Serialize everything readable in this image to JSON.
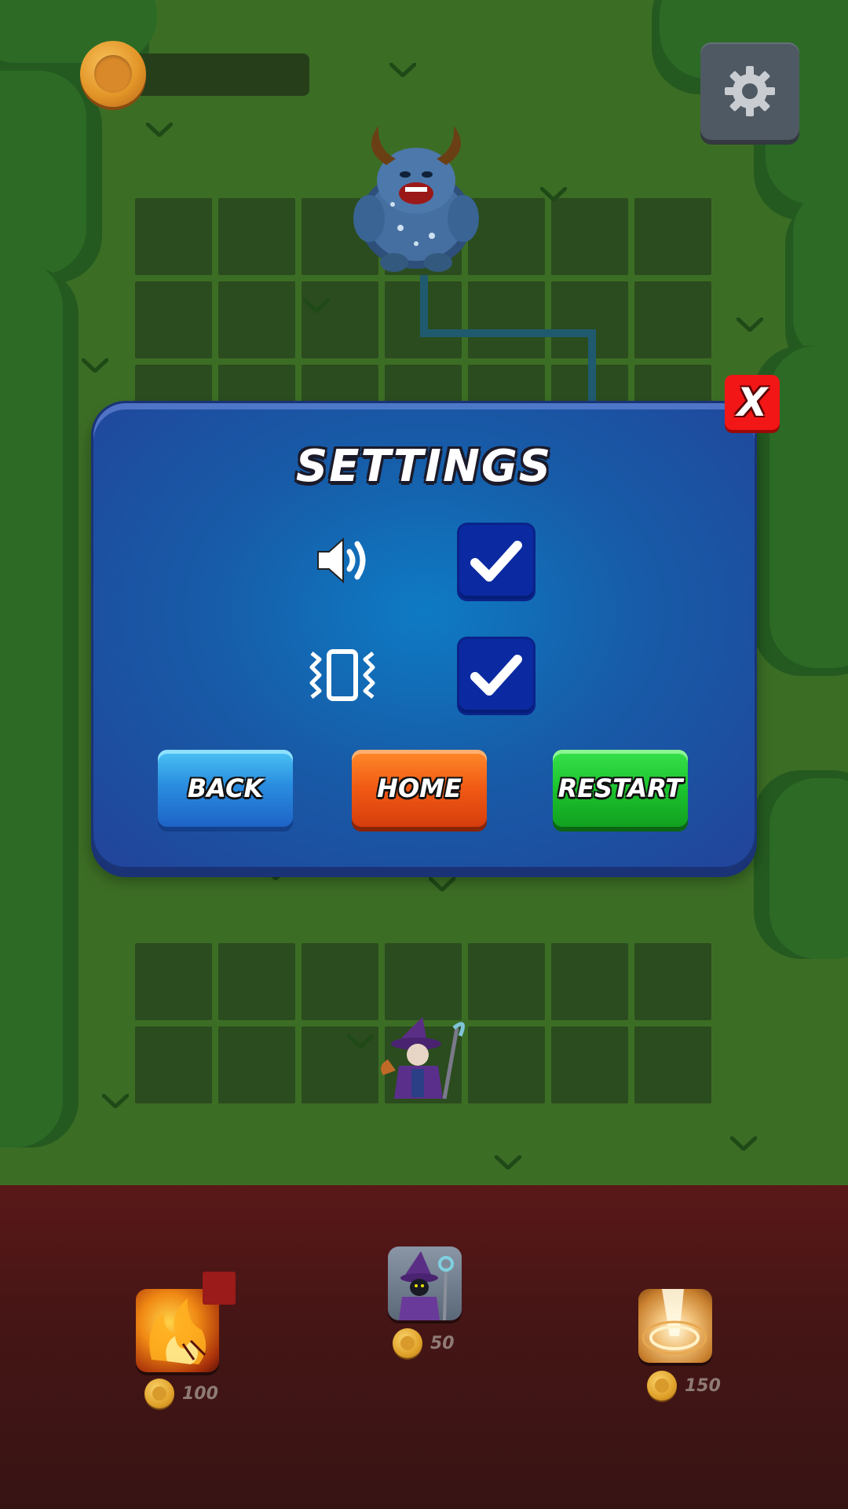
{
  "hud": {
    "coin_icon": "coin-icon",
    "settings_icon": "gear-icon"
  },
  "board": {
    "enemy": "horned-yeti-monster",
    "player": "purple-wizard"
  },
  "settings_dialog": {
    "title": "SETTINGS",
    "sound": {
      "icon": "speaker-icon",
      "enabled": true
    },
    "vibration": {
      "icon": "vibration-icon",
      "enabled": true
    },
    "close_label": "X",
    "back_label": "BACK",
    "home_label": "HOME",
    "restart_label": "RESTART",
    "colors": {
      "back": "#2a8ee0",
      "home": "#f05a14",
      "restart": "#1cc42e",
      "close": "#f21616"
    }
  },
  "shop": {
    "items": [
      {
        "name": "fire-spell",
        "price": "100",
        "locked_marker": true
      },
      {
        "name": "wizard-unit",
        "price": "50"
      },
      {
        "name": "light-beam-spell",
        "price": "150"
      }
    ]
  }
}
